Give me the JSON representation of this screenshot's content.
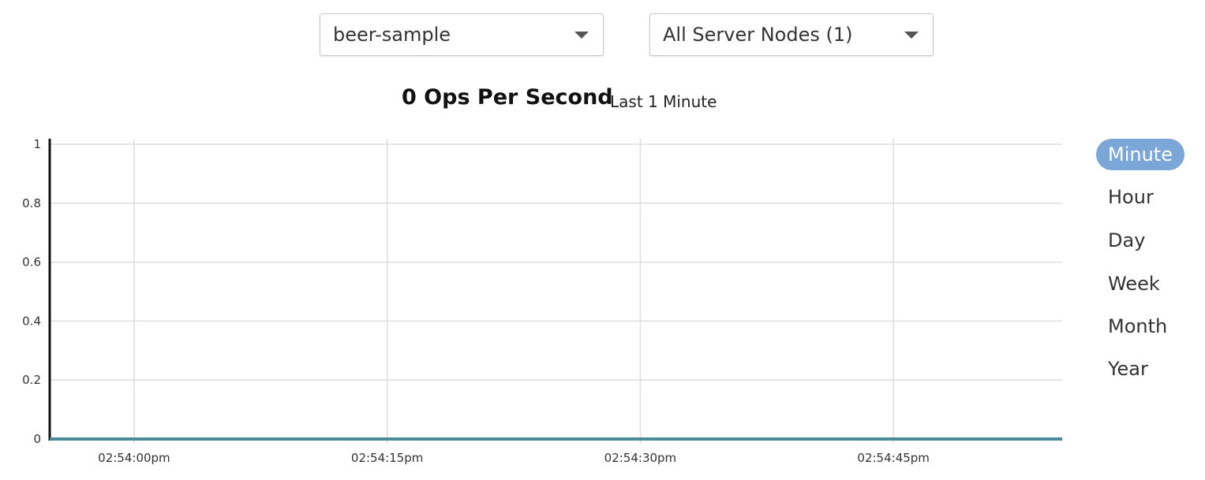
{
  "bucket_select": {
    "value": "beer-sample"
  },
  "node_select": {
    "value": "All Server Nodes (1)"
  },
  "chart_header": {
    "title": "0 Ops Per Second",
    "subtitle": "Last 1 Minute"
  },
  "zoom_options": [
    {
      "label": "Minute",
      "active": true
    },
    {
      "label": "Hour",
      "active": false
    },
    {
      "label": "Day",
      "active": false
    },
    {
      "label": "Week",
      "active": false
    },
    {
      "label": "Month",
      "active": false
    },
    {
      "label": "Year",
      "active": false
    }
  ],
  "colors": {
    "accent": "#7aa6d8",
    "series_line": "#4b8a9b",
    "grid": "#dddddd",
    "axis": "#111111"
  },
  "chart_data": {
    "type": "line",
    "title": "0 Ops Per Second",
    "subtitle": "Last 1 Minute",
    "xlabel": "",
    "ylabel": "",
    "ylim": [
      0,
      1
    ],
    "y_ticks": [
      0,
      0.2,
      0.4,
      0.6,
      0.8,
      1
    ],
    "y_tick_labels": [
      "0",
      "0.2",
      "0.4",
      "0.6",
      "0.8",
      "1"
    ],
    "x_ticks": [
      "02:54:00pm",
      "02:54:15pm",
      "02:54:30pm",
      "02:54:45pm"
    ],
    "xlim": [
      "02:53:55pm",
      "02:54:55pm"
    ],
    "grid": true,
    "series": [
      {
        "x": [
          "02:53:55pm",
          "02:54:55pm"
        ],
        "values": [
          0,
          0
        ]
      }
    ]
  }
}
